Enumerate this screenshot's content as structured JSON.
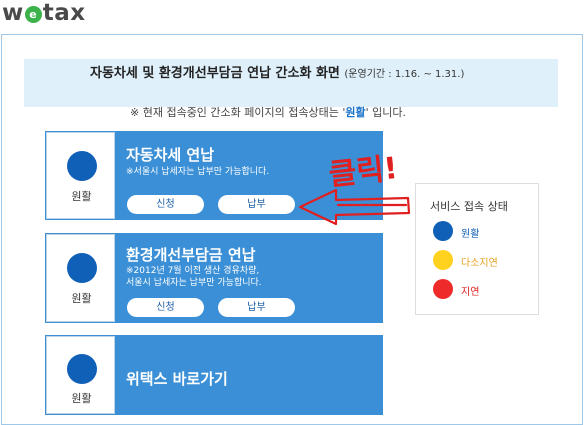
{
  "logo": {
    "prefix": "w",
    "mark": "e",
    "suffix": "tax"
  },
  "header": {
    "title": "자동차세 및 환경개선부담금 연납 간소화 화면",
    "period": "(운영기간 : 1.16. ~ 1.31.)"
  },
  "notice": {
    "prefix": "※ 현재 접속중인 간소화 페이지의 접속상태는 '",
    "status": "원활",
    "suffix": "' 입니다."
  },
  "cards": [
    {
      "status": "원활",
      "title": "자동차세 연납",
      "note": [
        "※서울시 납세자는 납부만 가능합니다."
      ],
      "buttons": [
        "신청",
        "납부"
      ]
    },
    {
      "status": "원활",
      "title": "환경개선부담금 연납",
      "note": [
        "※2012년 7월 이전 생산 경유차량,",
        "서울시 납세자는 납부만 가능합니다."
      ],
      "buttons": [
        "신청",
        "납부"
      ]
    },
    {
      "status": "원활",
      "title": "위택스 바로가기"
    }
  ],
  "legend": {
    "title": "서비스 접속 상태",
    "items": [
      {
        "label": "원활",
        "color": "#1060b8",
        "text_color": "#1060b8"
      },
      {
        "label": "다소지연",
        "color": "#ffd21f",
        "text_color": "#e8a020"
      },
      {
        "label": "지연",
        "color": "#ee2a2a",
        "text_color": "#e02020"
      }
    ]
  },
  "annotation": {
    "text": "클릭!",
    "color": "#e02020"
  }
}
